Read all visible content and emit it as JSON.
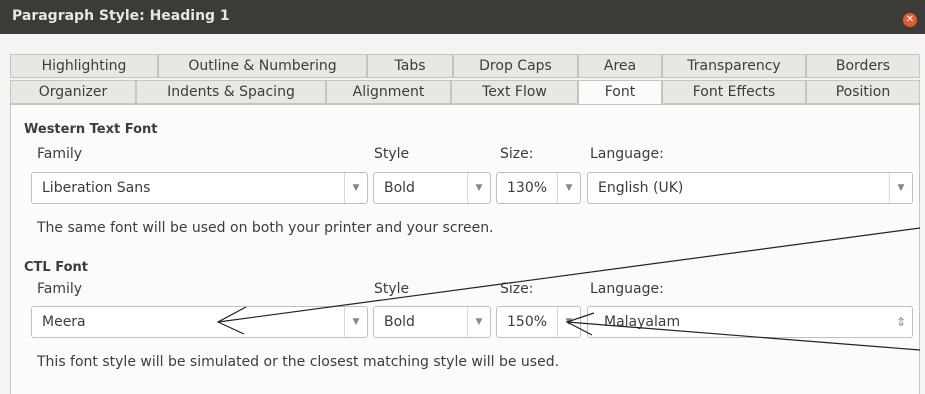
{
  "window": {
    "title": "Paragraph Style: Heading 1"
  },
  "tabs_row1": [
    "Highlighting",
    "Outline & Numbering",
    "Tabs",
    "Drop Caps",
    "Area",
    "Transparency",
    "Borders"
  ],
  "tabs_row2": [
    "Organizer",
    "Indents & Spacing",
    "Alignment",
    "Text Flow",
    "Font",
    "Font Effects",
    "Position"
  ],
  "active_tab": "Font",
  "western": {
    "heading": "Western Text Font",
    "family_label": "Family",
    "style_label": "Style",
    "size_label": "Size:",
    "language_label": "Language:",
    "family": "Liberation Sans",
    "style": "Bold",
    "size": "130%",
    "language": "English (UK)",
    "note": "The same font will be used on both your printer and your screen."
  },
  "ctl": {
    "heading": "CTL Font",
    "family_label": "Family",
    "style_label": "Style",
    "size_label": "Size:",
    "language_label": "Language:",
    "family": "Meera",
    "style": "Bold",
    "size": "150%",
    "language": "Malayalam",
    "note": "This font style will be simulated or the closest matching style will be used."
  }
}
